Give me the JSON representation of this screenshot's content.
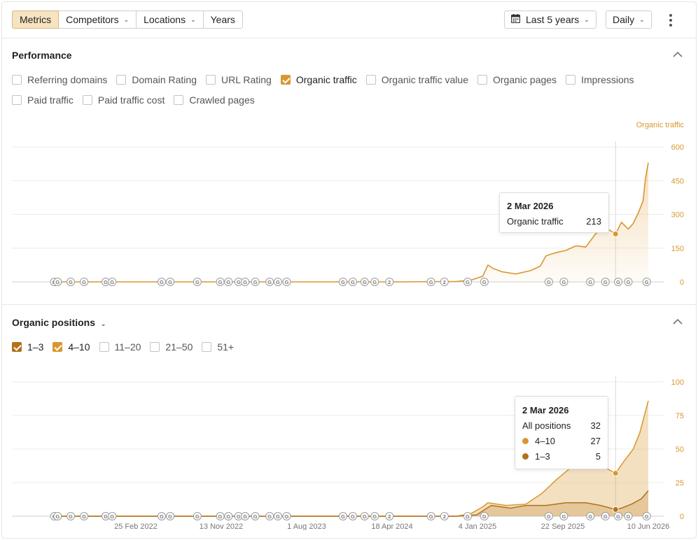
{
  "toolbar": {
    "tabs": [
      {
        "label": "Metrics",
        "active": true,
        "dropdown": false
      },
      {
        "label": "Competitors",
        "active": false,
        "dropdown": true
      },
      {
        "label": "Locations",
        "active": false,
        "dropdown": true
      },
      {
        "label": "Years",
        "active": false,
        "dropdown": false
      }
    ],
    "date_range": "Last 5 years",
    "interval": "Daily",
    "more_icon": "kebab-icon",
    "calendar_icon": "calendar-icon"
  },
  "performance": {
    "title": "Performance",
    "metrics": [
      {
        "label": "Referring domains",
        "checked": false
      },
      {
        "label": "Domain Rating",
        "checked": false
      },
      {
        "label": "URL Rating",
        "checked": false
      },
      {
        "label": "Organic traffic",
        "checked": true
      },
      {
        "label": "Organic traffic value",
        "checked": false
      },
      {
        "label": "Organic pages",
        "checked": false
      },
      {
        "label": "Impressions",
        "checked": false
      },
      {
        "label": "Paid traffic",
        "checked": false
      },
      {
        "label": "Paid traffic cost",
        "checked": false
      },
      {
        "label": "Crawled pages",
        "checked": false
      }
    ],
    "tooltip": {
      "date": "2 Mar 2026",
      "label": "Organic traffic",
      "value": "213"
    }
  },
  "positions": {
    "title": "Organic positions",
    "filters": [
      {
        "label": "1–3",
        "checked": true
      },
      {
        "label": "4–10",
        "checked": true
      },
      {
        "label": "11–20",
        "checked": false
      },
      {
        "label": "21–50",
        "checked": false
      },
      {
        "label": "51+",
        "checked": false
      }
    ],
    "tooltip": {
      "date": "2 Mar 2026",
      "all_label": "All positions",
      "all_value": "32",
      "rows": [
        {
          "label": "4–10",
          "value": "27",
          "color": "#d8972f"
        },
        {
          "label": "1–3",
          "value": "5",
          "color": "#b3701a"
        }
      ]
    }
  },
  "chart_data": [
    {
      "type": "line",
      "series_axis_label": "Organic traffic",
      "x_ticks": [
        "25 Feb 2022",
        "13 Nov 2022",
        "1 Aug 2023",
        "18 Apr 2024",
        "4 Jan 2025",
        "22 Sep 2025",
        "10 Jun 2026"
      ],
      "y_ticks": [
        "0",
        "150",
        "300",
        "450",
        "600"
      ],
      "ylim": [
        0,
        600
      ],
      "color": "#d8972f",
      "series": [
        {
          "name": "Organic traffic",
          "points": [
            [
              "2021-06-21",
              0
            ],
            [
              "2024-05-01",
              0
            ],
            [
              "2024-11-01",
              2
            ],
            [
              "2024-12-15",
              8
            ],
            [
              "2025-01-20",
              25
            ],
            [
              "2025-02-05",
              75
            ],
            [
              "2025-02-20",
              60
            ],
            [
              "2025-03-20",
              45
            ],
            [
              "2025-05-01",
              35
            ],
            [
              "2025-06-15",
              50
            ],
            [
              "2025-07-15",
              70
            ],
            [
              "2025-08-01",
              115
            ],
            [
              "2025-08-10",
              120
            ],
            [
              "2025-09-01",
              130
            ],
            [
              "2025-10-01",
              140
            ],
            [
              "2025-11-01",
              160
            ],
            [
              "2025-12-01",
              155
            ],
            [
              "2026-01-01",
              215
            ],
            [
              "2026-02-01",
              240
            ],
            [
              "2026-03-02",
              213
            ],
            [
              "2026-03-20",
              265
            ],
            [
              "2026-04-10",
              235
            ],
            [
              "2026-04-25",
              260
            ],
            [
              "2026-05-10",
              305
            ],
            [
              "2026-05-25",
              360
            ],
            [
              "2026-06-01",
              455
            ],
            [
              "2026-06-05",
              490
            ],
            [
              "2026-06-10",
              530
            ]
          ]
        }
      ],
      "annotations": [
        {
          "marker": "G",
          "date": "2021-06-21"
        },
        {
          "marker": "G",
          "date": "2021-07-01"
        },
        {
          "marker": "G",
          "date": "2021-08-10"
        },
        {
          "marker": "G",
          "date": "2021-09-20"
        },
        {
          "marker": "G",
          "date": "2021-11-25"
        },
        {
          "marker": "G",
          "date": "2021-12-15"
        },
        {
          "marker": "G",
          "date": "2022-05-15"
        },
        {
          "marker": "G",
          "date": "2022-06-10"
        },
        {
          "marker": "G",
          "date": "2022-09-01"
        },
        {
          "marker": "G",
          "date": "2022-11-10"
        },
        {
          "marker": "G",
          "date": "2022-12-05"
        },
        {
          "marker": "G",
          "date": "2023-01-05"
        },
        {
          "marker": "G",
          "date": "2023-01-25"
        },
        {
          "marker": "G",
          "date": "2023-02-25"
        },
        {
          "marker": "G",
          "date": "2023-04-10"
        },
        {
          "marker": "G",
          "date": "2023-05-05"
        },
        {
          "marker": "G",
          "date": "2023-06-01"
        },
        {
          "marker": "G",
          "date": "2023-11-20"
        },
        {
          "marker": "G",
          "date": "2023-12-20"
        },
        {
          "marker": "G",
          "date": "2024-01-25"
        },
        {
          "marker": "G",
          "date": "2024-02-25"
        },
        {
          "marker": "2",
          "date": "2024-04-10"
        },
        {
          "marker": "G",
          "date": "2024-08-15"
        },
        {
          "marker": "2",
          "date": "2024-09-25"
        },
        {
          "marker": "G",
          "date": "2024-12-05"
        },
        {
          "marker": "G",
          "date": "2025-01-25"
        },
        {
          "marker": "G",
          "date": "2025-08-10"
        },
        {
          "marker": "G",
          "date": "2025-09-25"
        },
        {
          "marker": "G",
          "date": "2025-12-15"
        },
        {
          "marker": "G",
          "date": "2026-01-30"
        },
        {
          "marker": "G",
          "date": "2026-03-10"
        },
        {
          "marker": "G",
          "date": "2026-04-10"
        },
        {
          "marker": "G",
          "date": "2026-06-05"
        }
      ]
    },
    {
      "type": "area",
      "x_ticks": [
        "25 Feb 2022",
        "13 Nov 2022",
        "1 Aug 2023",
        "18 Apr 2024",
        "4 Jan 2025",
        "22 Sep 2025",
        "10 Jun 2026"
      ],
      "y_ticks": [
        "0",
        "25",
        "50",
        "75",
        "100"
      ],
      "ylim": [
        0,
        100
      ],
      "series": [
        {
          "name": "1–3",
          "color": "#b3701a",
          "points": [
            [
              "2021-06-21",
              0
            ],
            [
              "2024-11-01",
              0
            ],
            [
              "2025-01-01",
              1
            ],
            [
              "2025-02-15",
              8
            ],
            [
              "2025-04-15",
              6
            ],
            [
              "2025-06-01",
              8
            ],
            [
              "2025-08-01",
              8
            ],
            [
              "2025-10-01",
              10
            ],
            [
              "2025-12-01",
              10
            ],
            [
              "2026-01-15",
              8
            ],
            [
              "2026-03-02",
              5
            ],
            [
              "2026-03-20",
              6
            ],
            [
              "2026-04-20",
              9
            ],
            [
              "2026-05-20",
              13
            ],
            [
              "2026-06-10",
              19
            ]
          ]
        },
        {
          "name": "4–10",
          "color": "#d8972f",
          "points": [
            [
              "2021-06-21",
              0
            ],
            [
              "2024-11-01",
              0
            ],
            [
              "2024-12-15",
              2
            ],
            [
              "2025-01-20",
              7
            ],
            [
              "2025-02-05",
              10
            ],
            [
              "2025-04-01",
              8
            ],
            [
              "2025-06-01",
              9
            ],
            [
              "2025-07-20",
              17
            ],
            [
              "2025-09-01",
              27
            ],
            [
              "2025-10-15",
              36
            ],
            [
              "2025-12-01",
              40
            ],
            [
              "2026-01-15",
              38
            ],
            [
              "2026-03-02",
              32
            ],
            [
              "2026-03-25",
              40
            ],
            [
              "2026-04-25",
              50
            ],
            [
              "2026-05-15",
              62
            ],
            [
              "2026-05-30",
              76
            ],
            [
              "2026-06-10",
              86
            ]
          ]
        }
      ],
      "tooltip_date": "2026-03-02"
    }
  ]
}
